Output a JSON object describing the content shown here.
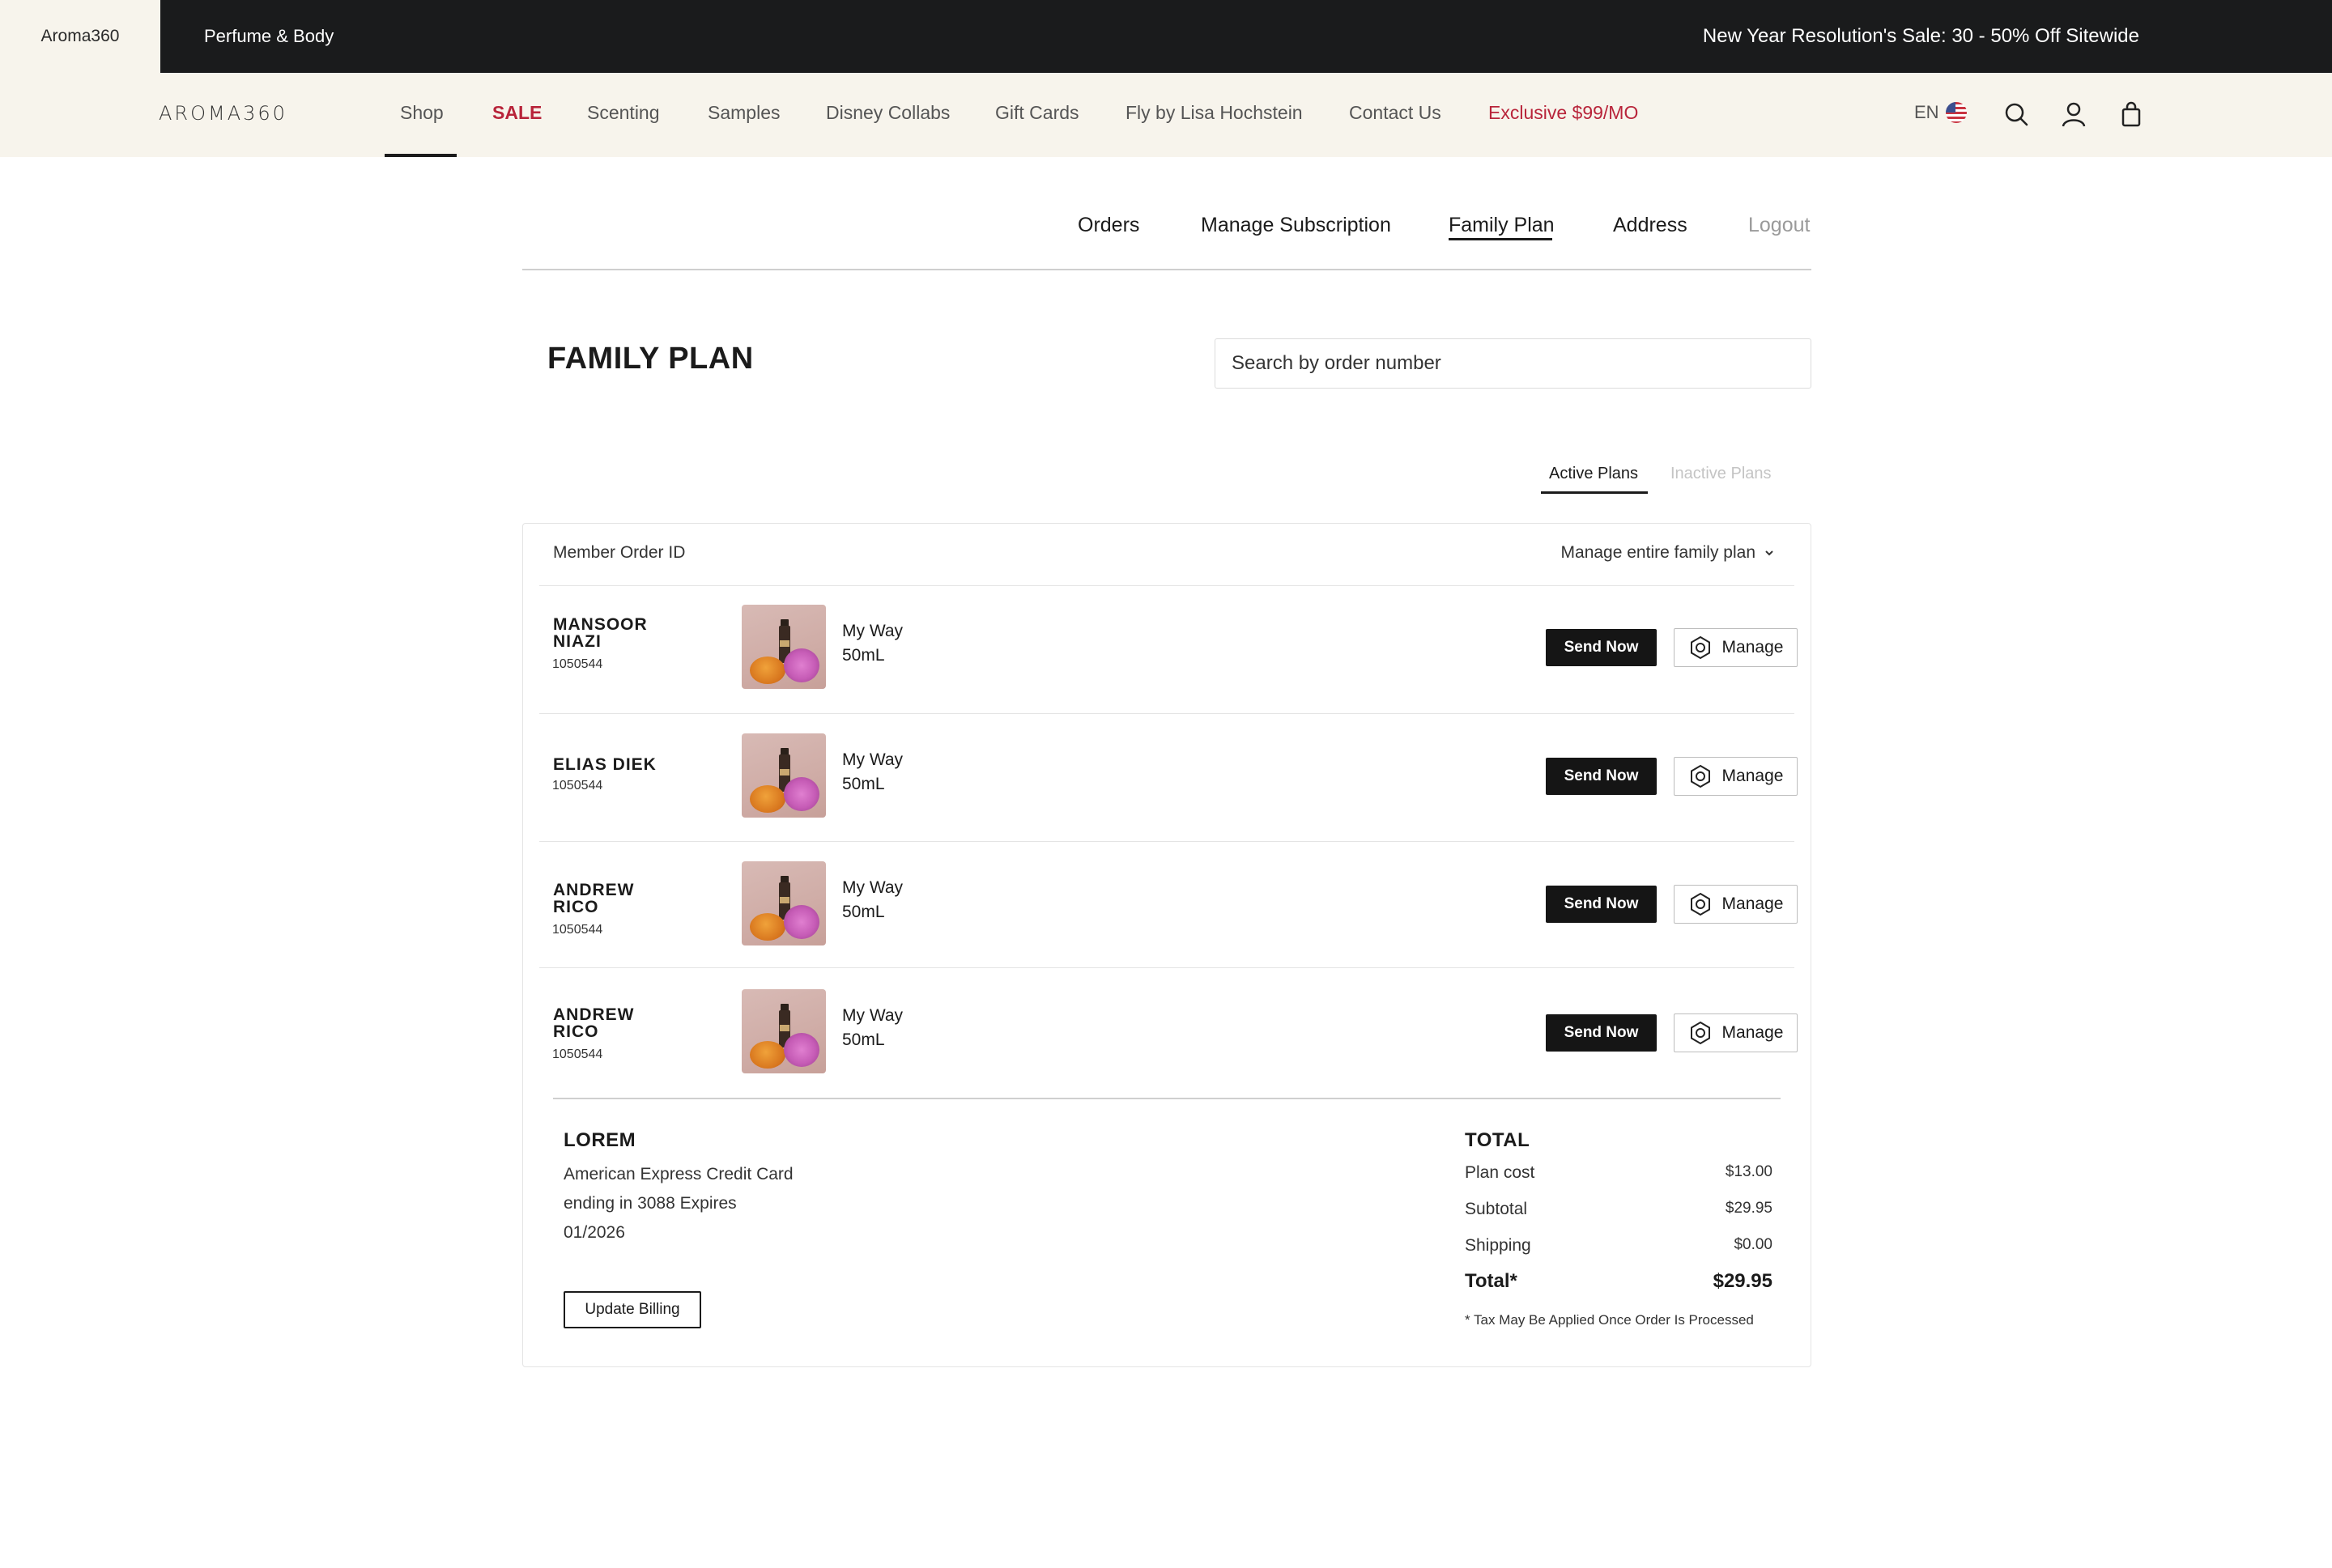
{
  "topbar": {
    "brand_tab": "Aroma360",
    "perfume_tab": "Perfume & Body",
    "promo": "New Year Resolution's Sale: 30 - 50% Off Sitewide"
  },
  "nav": {
    "logo": "AROMA360",
    "links": [
      "Shop",
      "SALE",
      "Scenting",
      "Samples",
      "Disney Collabs",
      "Gift Cards",
      "Fly by Lisa Hochstein",
      "Contact Us",
      "Exclusive $99/MO"
    ],
    "lang": "EN",
    "icons": [
      "us-flag-icon",
      "search-icon",
      "account-icon",
      "bag-icon"
    ],
    "sale_color": "#b8243a"
  },
  "account_tabs": [
    "Orders",
    "Manage Subscription",
    "Family Plan",
    "Address",
    "Logout"
  ],
  "page": {
    "title": "FAMILY PLAN",
    "search_placeholder": "Search by order number",
    "plan_tabs": {
      "active": "Active Plans",
      "inactive": "Inactive Plans"
    }
  },
  "table": {
    "column_label": "Member Order ID",
    "manage_all": "Manage entire family plan",
    "send_label": "Send Now",
    "manage_label": "Manage",
    "rows": [
      {
        "name_line1": "MANSOOR",
        "name_line2": "NIAZI",
        "order_id": "1050544",
        "product": "My Way",
        "size": "50mL"
      },
      {
        "name_line1": "ELIAS DIEK",
        "name_line2": "",
        "order_id": "1050544",
        "product": "My Way",
        "size": "50mL"
      },
      {
        "name_line1": "ANDREW",
        "name_line2": "RICO",
        "order_id": "1050544",
        "product": "My Way",
        "size": "50mL"
      },
      {
        "name_line1": "ANDREW",
        "name_line2": "RICO",
        "order_id": "1050544",
        "product": "My Way",
        "size": "50mL"
      }
    ]
  },
  "billing": {
    "title": "LOREM",
    "line1": "American Express Credit Card",
    "line2": "ending in 3088 Expires",
    "line3": "01/2026",
    "update_label": "Update Billing"
  },
  "totals": {
    "title": "TOTAL",
    "plan_cost_label": "Plan cost",
    "plan_cost": "$13.00",
    "subtotal_label": "Subtotal",
    "subtotal": "$29.95",
    "shipping_label": "Shipping",
    "shipping": "$0.00",
    "total_label": "Total*",
    "total": "$29.95",
    "tax_note": "* Tax May Be Applied Once Order Is Processed"
  }
}
